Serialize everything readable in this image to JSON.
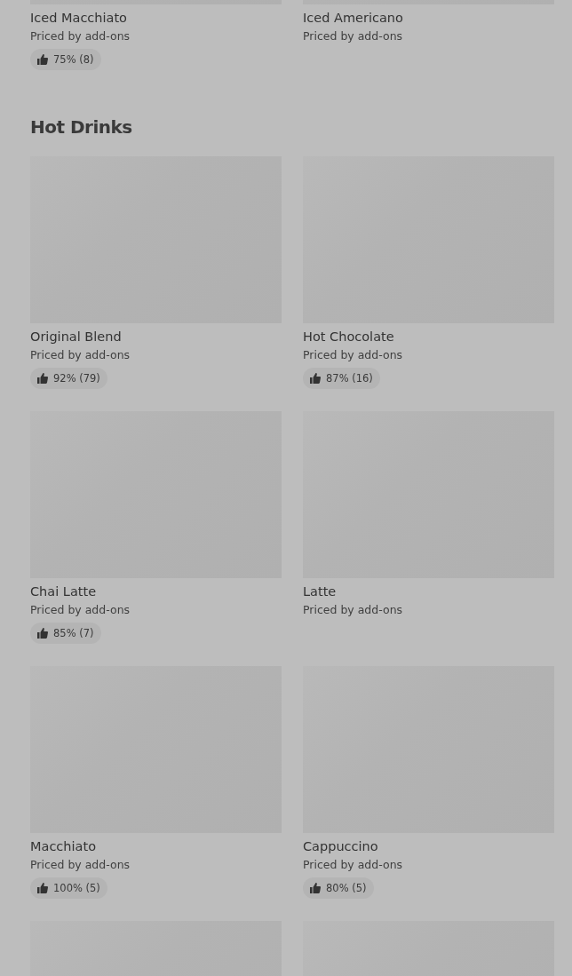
{
  "sections": [
    {
      "items": [
        {
          "kind": "product",
          "name": "Iced Macchiato",
          "price": "Priced by add-ons",
          "rating": "75% (8)"
        },
        {
          "kind": "product",
          "name": "Iced Americano",
          "price": "Priced by add-ons"
        }
      ]
    },
    {
      "title": "Hot Drinks",
      "items": [
        {
          "kind": "product",
          "name": "Original Blend",
          "price": "Priced by add-ons",
          "rating": "92% (79)"
        },
        {
          "kind": "product",
          "name": "Hot Chocolate",
          "price": "Priced by add-ons",
          "rating": "87% (16)"
        },
        {
          "kind": "product",
          "name": "Chai Latte",
          "price": "Priced by add-ons",
          "rating": "85% (7)"
        },
        {
          "kind": "product",
          "name": "Latte",
          "price": "Priced by add-ons"
        },
        {
          "kind": "product",
          "name": "Macchiato",
          "price": "Priced by add-ons",
          "rating": "100% (5)"
        },
        {
          "kind": "product",
          "name": "Cappuccino",
          "price": "Priced by add-ons",
          "rating": "80% (5)"
        },
        {
          "kind": "loading"
        },
        {
          "kind": "loading"
        }
      ]
    }
  ]
}
